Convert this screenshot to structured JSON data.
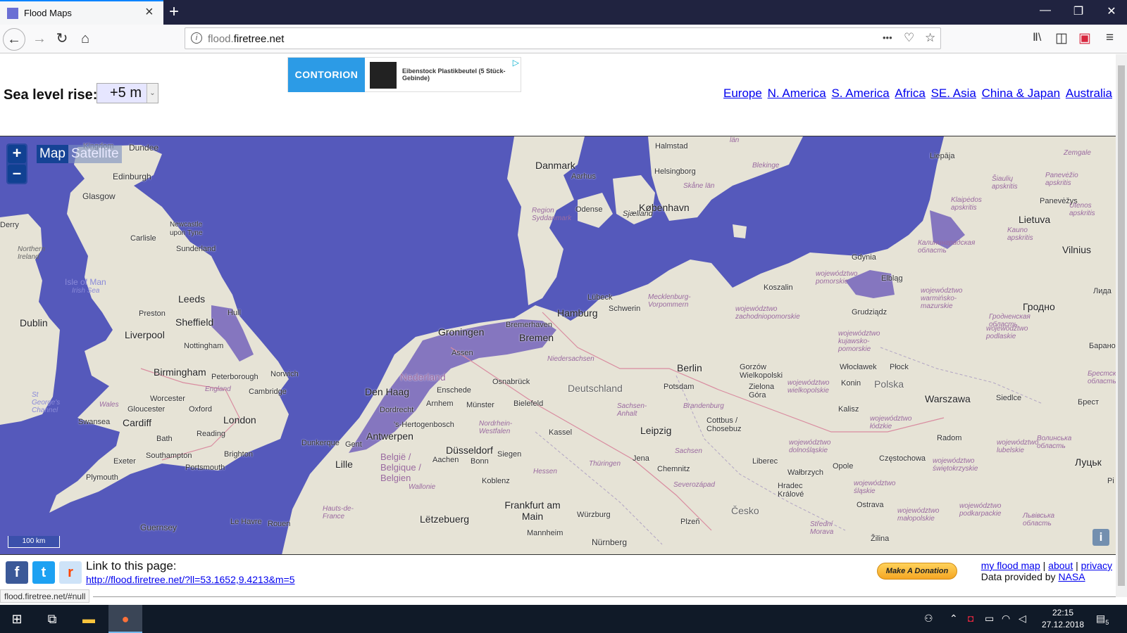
{
  "browser": {
    "tab_title": "Flood Maps",
    "url_prefix": "flood.",
    "url_domain": "firetree.net",
    "new_tab_icon": "plus-icon",
    "close_icon": "close-icon"
  },
  "window_controls": {
    "minimize": "—",
    "restore": "❐",
    "close": "✕"
  },
  "nav": {
    "back": "←",
    "forward": "→",
    "reload": "↻",
    "home": "⌂"
  },
  "url_actions": {
    "more": "•••",
    "pocket": "♡",
    "bookmark": "☆"
  },
  "toolbar_icons": {
    "library": "Ⅱ\\",
    "sidebar": "◫",
    "extension": "▣",
    "menu": "≡"
  },
  "controls": {
    "sea_level_label": "Sea level rise:",
    "sea_level_value": "+5 m",
    "dropdown_arrow": "⌄"
  },
  "ad": {
    "brand": "CONTORION",
    "text": "Eibenstock Plastikbeutel (5 Stück-Gebinde)",
    "choice_icon": "▷"
  },
  "regions": [
    "Europe",
    "N. America",
    "S. America",
    "Africa",
    "SE. Asia",
    "China & Japan",
    "Australia"
  ],
  "map": {
    "zoom_in": "+",
    "zoom_out": "–",
    "layer_map": "Map",
    "layer_satellite": "Satellite",
    "scale": "100 km",
    "info": "i",
    "colors": {
      "water": "#5559bb",
      "land": "#e6e3d6",
      "flood": "#7a69bd"
    },
    "places": {
      "dundee": "Dundee",
      "edinburgh": "Edinburgh",
      "glasgow": "Glasgow",
      "newcastle": "Newcastle upon Tyne",
      "carlisle": "Carlisle",
      "sunderland": "Sunderland",
      "northern_ireland": "Northern Ireland",
      "isle_of_man": "Isle of Man",
      "leeds": "Leeds",
      "dublin": "Dublin",
      "preston": "Preston",
      "sheffield": "Sheffield",
      "hull": "Hull",
      "liverpool": "Liverpool",
      "nottingham": "Nottingham",
      "birmingham": "Birmingham",
      "peterborough": "Peterborough",
      "norwich": "Norwich",
      "england": "England",
      "cambridge": "Cambridge",
      "worcester": "Worcester",
      "wales": "Wales",
      "gloucester": "Gloucester",
      "oxford": "Oxford",
      "swansea": "Swansea",
      "cardiff": "Cardiff",
      "london": "London",
      "bath": "Bath",
      "reading": "Reading",
      "exeter": "Exeter",
      "southampton": "Southampton",
      "brighton": "Brighton",
      "portsmouth": "Portsmouth",
      "plymouth": "Plymouth",
      "guernsey": "Guernsey",
      "le_havre": "Le Havre",
      "rouen": "Rouen",
      "hauts_de_france": "Hauts-de-France",
      "lille": "Lille",
      "dunkerque": "Dunkerque",
      "gent": "Gent",
      "antwerpen": "Antwerpen",
      "belgie": "België / Belgique / Belgien",
      "wallonie": "Wallonie",
      "letzebuerg": "Lëtzebuerg",
      "den_haag": "Den Haag",
      "dordrecht": "Dordrecht",
      "hertogenbosch": "'s-Hertogenbosch",
      "nederland": "Nederland",
      "arnhem": "Arnhem",
      "enschede": "Enschede",
      "groningen": "Groningen",
      "assen": "Assen",
      "muenster": "Münster",
      "bielefeld": "Bielefeld",
      "osnabrueck": "Osnabrück",
      "duesseldorf": "Düsseldorf",
      "aachen": "Aachen",
      "bonn": "Bonn",
      "siegen": "Siegen",
      "koblenz": "Koblenz",
      "nrw": "Nordrhein-Westfalen",
      "kassel": "Kassel",
      "hessen": "Hessen",
      "frankfurt": "Frankfurt am Main",
      "mannheim": "Mannheim",
      "wuerzburg": "Würzburg",
      "nuernberg": "Nürnberg",
      "bremen": "Bremen",
      "bremerhaven": "Bremerhaven",
      "hamburg": "Hamburg",
      "niedersachsen": "Niedersachsen",
      "deutschland": "Deutschland",
      "luebeck": "Lübeck",
      "schwerin": "Schwerin",
      "mecklenburg": "Mecklenburg-Vorpommern",
      "berlin": "Berlin",
      "potsdam": "Potsdam",
      "brandenburg": "Brandenburg",
      "sachsen_anhalt": "Sachsen-Anhalt",
      "leipzig": "Leipzig",
      "jena": "Jena",
      "thueringen": "Thüringen",
      "chemnitz": "Chemnitz",
      "sachsen": "Sachsen",
      "cottbus": "Cottbus / Chosebuz",
      "danmark": "Danmark",
      "aarhus": "Aarhus",
      "odense": "Odense",
      "sjaelland": "Sjælland",
      "koebenhavn": "København",
      "helsingborg": "Helsingborg",
      "halmstad": "Halmstad",
      "skane": "Skåne län",
      "blekinge": "Blekinge",
      "lan": "län",
      "liepaja": "Liepāja",
      "zemgale": "Zemgale",
      "siauliu": "Šiaulių apskritis",
      "panevezio": "Panevėžio apskritis",
      "panevezys": "Panevėžys",
      "lietuva": "Lietuva",
      "utenos": "Utenos apskritis",
      "klaipedos": "Klaipėdos apskritis",
      "kauno": "Kauno apskritis",
      "vilnius": "Vilnius",
      "kaliningrad": "Калининградская область",
      "gdynia": "Gdynia",
      "elblag": "Elbląg",
      "koszalin": "Koszalin",
      "lida": "Лида",
      "grodno": "Гродно",
      "grudziadz": "Grudziądz",
      "pomorskie": "województwo pomorskie",
      "zach_pom": "województwo zachodniopomorskie",
      "warm_maz": "województwo warmińsko-mazurskie",
      "kuj_pom": "województwo kujawsko-pomorskie",
      "podlaskie": "województwo podlaskie",
      "wloclawek": "Włocławek",
      "plock": "Płock",
      "gorzow": "Gorzów Wielkopolski",
      "wielkopolskie": "województwo wielkopolskie",
      "konin": "Konin",
      "polska": "Polska",
      "warszawa": "Warszawa",
      "siedlce": "Siedlce",
      "zielona_gora": "Zielona Góra",
      "kalisz": "Kalisz",
      "lodzkie": "województwo łódzkie",
      "brest": "Брест",
      "brest_obl": "Брестская область",
      "grodno_obl": "Гродненская область",
      "baranovichi": "Барано",
      "radom": "Radom",
      "lubelskie": "województwo lubelskie",
      "dolnoslaskie": "województwo dolnośląskie",
      "liberec": "Liberec",
      "opole": "Opole",
      "czestochowa": "Częstochowa",
      "walbrzych": "Wałbrzych",
      "swietokrzyskie": "województwo świętokrzyskie",
      "lutsk": "Луцьк",
      "volyn": "Волинська область",
      "hradec": "Hradec Králové",
      "slaskie": "województwo śląskie",
      "cesko": "Česko",
      "severozapad": "Severozápad",
      "plzen": "Plzeň",
      "ostrava": "Ostrava",
      "malopolskie": "województwo małopolskie",
      "podkarpackie": "województwo podkarpackie",
      "lviv": "Львівська область",
      "stredni_morava": "Střední Morava",
      "zilina": "Žilina",
      "pi": "Pi",
      "st_georges": "St George's Channel",
      "irish_sea": "Irish Sea",
      "region_syd": "Region Syddanmark",
      "kingdom": "Kingdom",
      "derry": "Derry"
    }
  },
  "footer": {
    "link_label": "Link to this page:",
    "link_url": "http://flood.firetree.net/?ll=53.1652,9.4213&m=5",
    "facebook": "f",
    "twitter": "t",
    "reddit": "r",
    "donate": "Make A Donation",
    "my_flood_map": "my flood map",
    "about": "about",
    "privacy": "privacy",
    "sep": "|",
    "data_provided": "Data provided by",
    "nasa": "NASA"
  },
  "status_url": "flood.firetree.net/#null",
  "taskbar": {
    "time": "22:15",
    "date": "27.12.2018",
    "notifications": "5"
  }
}
